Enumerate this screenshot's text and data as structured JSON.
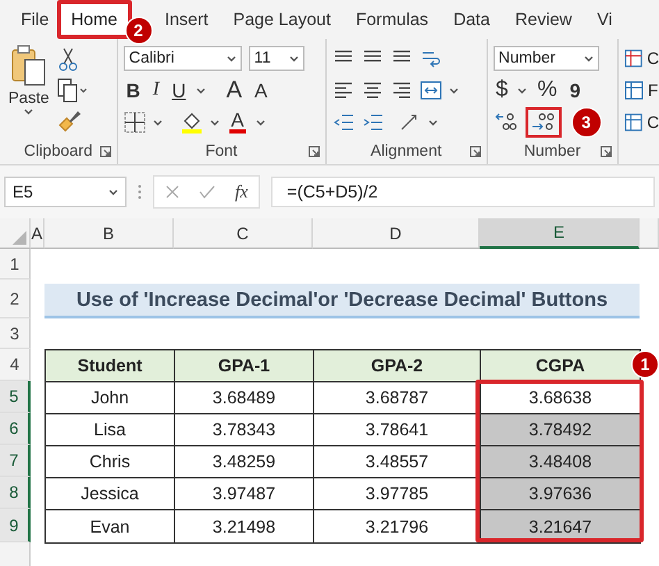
{
  "tabs": [
    {
      "label": "File",
      "selected": false,
      "highlighted": false
    },
    {
      "label": "Home",
      "selected": true,
      "highlighted": true,
      "callout": "2"
    },
    {
      "label": "Insert",
      "selected": false,
      "highlighted": false
    },
    {
      "label": "Page Layout",
      "selected": false,
      "highlighted": false
    },
    {
      "label": "Formulas",
      "selected": false,
      "highlighted": false
    },
    {
      "label": "Data",
      "selected": false,
      "highlighted": false
    },
    {
      "label": "Review",
      "selected": false,
      "highlighted": false
    },
    {
      "label": "Vi",
      "selected": false,
      "highlighted": false
    }
  ],
  "clipboard": {
    "paste": "Paste",
    "label": "Clipboard"
  },
  "font": {
    "name": "Calibri",
    "size": "11",
    "bold": "B",
    "italic": "I",
    "underline": "U",
    "grow": "A",
    "shrink": "A",
    "font_color_letter": "A",
    "label": "Font"
  },
  "alignment": {
    "label": "Alignment"
  },
  "number": {
    "format": "Number",
    "currency": "$",
    "percent": "%",
    "comma": "9",
    "decrease_decimal": {
      "highlighted": true,
      "callout": "3"
    },
    "label": "Number"
  },
  "styles": {
    "items": [
      "C",
      "F",
      "C"
    ]
  },
  "formula_bar": {
    "name_box": "E5",
    "fx": "fx",
    "formula": "=(C5+D5)/2"
  },
  "columns": [
    {
      "label": "A",
      "selected": false
    },
    {
      "label": "B",
      "selected": false
    },
    {
      "label": "C",
      "selected": false
    },
    {
      "label": "D",
      "selected": false
    },
    {
      "label": "E",
      "selected": true
    }
  ],
  "row_numbers": [
    {
      "label": "1",
      "selected": false
    },
    {
      "label": "2",
      "selected": false
    },
    {
      "label": "3",
      "selected": false
    },
    {
      "label": "4",
      "selected": false
    },
    {
      "label": "5",
      "selected": true
    },
    {
      "label": "6",
      "selected": true
    },
    {
      "label": "7",
      "selected": true
    },
    {
      "label": "8",
      "selected": true
    },
    {
      "label": "9",
      "selected": true
    }
  ],
  "title": "Use of 'Increase Decimal'or 'Decrease Decimal' Buttons",
  "table": {
    "headers": [
      "Student",
      "GPA-1",
      "GPA-2",
      "CGPA"
    ],
    "highlight": {
      "on": true,
      "callout": "1"
    },
    "rows": [
      {
        "student": "John",
        "gpa1": "3.68489",
        "gpa2": "3.68787",
        "cgpa": "3.68638",
        "shaded": false
      },
      {
        "student": "Lisa",
        "gpa1": "3.78343",
        "gpa2": "3.78641",
        "cgpa": "3.78492",
        "shaded": true
      },
      {
        "student": "Chris",
        "gpa1": "3.48259",
        "gpa2": "3.48557",
        "cgpa": "3.48408",
        "shaded": true
      },
      {
        "student": "Jessica",
        "gpa1": "3.97487",
        "gpa2": "3.97785",
        "cgpa": "3.97636",
        "shaded": true
      },
      {
        "student": "Evan",
        "gpa1": "3.21498",
        "gpa2": "3.21796",
        "cgpa": "3.21647",
        "shaded": true
      }
    ]
  }
}
